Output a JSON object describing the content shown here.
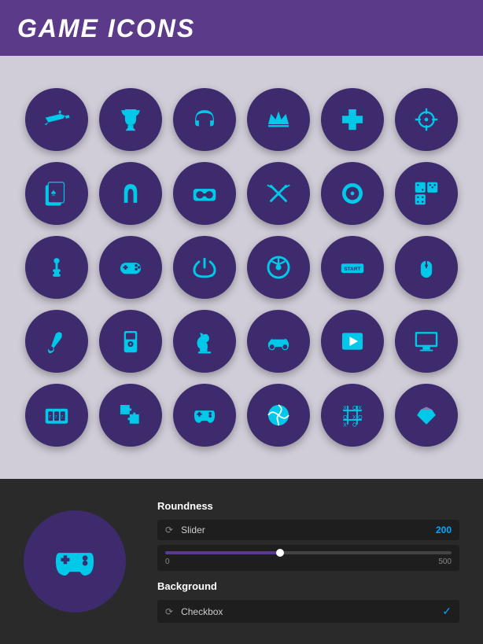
{
  "header": {
    "title": "GAME ICONS"
  },
  "icons": [
    {
      "name": "ray-gun",
      "row": 1,
      "col": 1
    },
    {
      "name": "trophy",
      "row": 1,
      "col": 2
    },
    {
      "name": "headphones",
      "row": 1,
      "col": 3
    },
    {
      "name": "crown",
      "row": 1,
      "col": 4
    },
    {
      "name": "dpad",
      "row": 1,
      "col": 5
    },
    {
      "name": "crosshair",
      "row": 1,
      "col": 6
    },
    {
      "name": "playing-cards",
      "row": 2,
      "col": 1
    },
    {
      "name": "horseshoe",
      "row": 2,
      "col": 2
    },
    {
      "name": "vr-headset",
      "row": 2,
      "col": 3
    },
    {
      "name": "swords",
      "row": 2,
      "col": 4
    },
    {
      "name": "disc",
      "row": 2,
      "col": 5
    },
    {
      "name": "dice",
      "row": 2,
      "col": 6
    },
    {
      "name": "joystick",
      "row": 3,
      "col": 1
    },
    {
      "name": "gamepad",
      "row": 3,
      "col": 2
    },
    {
      "name": "power-button",
      "row": 3,
      "col": 3
    },
    {
      "name": "steering-wheel",
      "row": 3,
      "col": 4
    },
    {
      "name": "start-button",
      "row": 3,
      "col": 5
    },
    {
      "name": "mouse",
      "row": 3,
      "col": 6
    },
    {
      "name": "guitar",
      "row": 4,
      "col": 1
    },
    {
      "name": "mp3-player",
      "row": 4,
      "col": 2
    },
    {
      "name": "chess-knight",
      "row": 4,
      "col": 3
    },
    {
      "name": "racing-car",
      "row": 4,
      "col": 4
    },
    {
      "name": "play-button",
      "row": 4,
      "col": 5
    },
    {
      "name": "monitor",
      "row": 4,
      "col": 6
    },
    {
      "name": "slot-machine",
      "row": 5,
      "col": 1
    },
    {
      "name": "puzzle",
      "row": 5,
      "col": 2
    },
    {
      "name": "gamepad2",
      "row": 5,
      "col": 3
    },
    {
      "name": "beach-ball",
      "row": 5,
      "col": 4
    },
    {
      "name": "tic-tac-toe",
      "row": 5,
      "col": 5
    },
    {
      "name": "gem",
      "row": 5,
      "col": 6
    }
  ],
  "controls": {
    "roundness_label": "Roundness",
    "slider_label": "Slider",
    "slider_value": "200",
    "slider_min": "0",
    "slider_max": "500",
    "background_label": "Background",
    "checkbox_label": "Checkbox",
    "checkbox_checked": true
  }
}
